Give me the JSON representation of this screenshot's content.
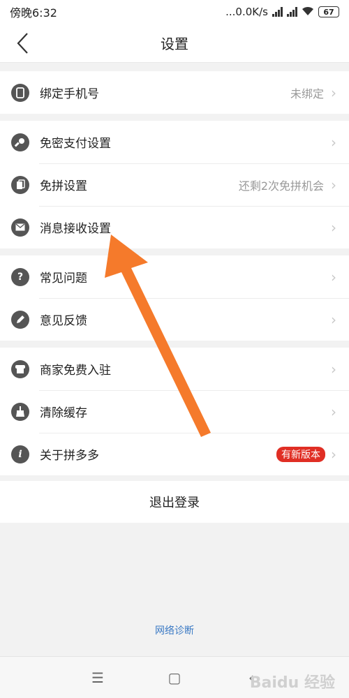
{
  "status": {
    "time": "傍晚6:32",
    "speed": "...0.0K/s",
    "battery": "67"
  },
  "nav": {
    "title": "设置"
  },
  "groups": [
    {
      "rows": [
        {
          "label": "绑定手机号",
          "value": "未绑定",
          "icon": "phone-icon"
        }
      ]
    },
    {
      "rows": [
        {
          "label": "免密支付设置",
          "value": "",
          "icon": "key-icon"
        },
        {
          "label": "免拼设置",
          "value": "还剩2次免拼机会",
          "icon": "cards-icon"
        },
        {
          "label": "消息接收设置",
          "value": "",
          "icon": "mail-icon"
        }
      ]
    },
    {
      "rows": [
        {
          "label": "常见问题",
          "value": "",
          "icon": "question-icon"
        },
        {
          "label": "意见反馈",
          "value": "",
          "icon": "pencil-icon"
        }
      ]
    },
    {
      "rows": [
        {
          "label": "商家免费入驻",
          "value": "",
          "icon": "store-icon"
        },
        {
          "label": "清除缓存",
          "value": "",
          "icon": "broom-icon"
        },
        {
          "label": "关于拼多多",
          "badge": "有新版本",
          "icon": "info-icon"
        }
      ]
    }
  ],
  "logout": "退出登录",
  "diagnose": "网络诊断",
  "watermark": "Baidu 经验",
  "colors": {
    "accent_link": "#3a79c4",
    "badge": "#e02e24",
    "arrow": "#f57a2b"
  }
}
